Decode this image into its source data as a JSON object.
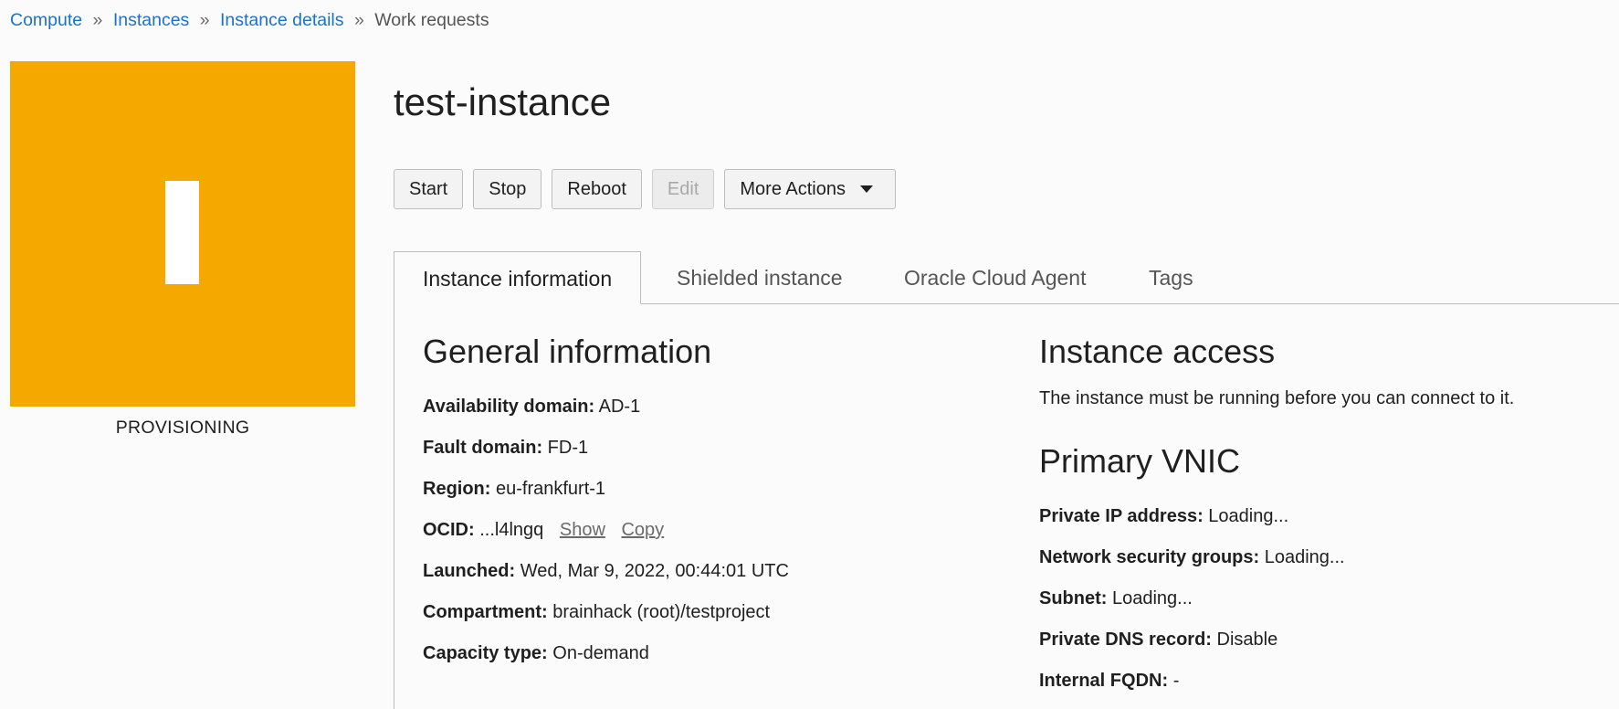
{
  "breadcrumb": {
    "items": [
      "Compute",
      "Instances",
      "Instance details"
    ],
    "current": "Work requests",
    "separator": "»"
  },
  "status": {
    "state": "PROVISIONING",
    "color": "#f5a800"
  },
  "instance": {
    "name": "test-instance"
  },
  "actions": {
    "start": "Start",
    "stop": "Stop",
    "reboot": "Reboot",
    "edit": "Edit",
    "more": "More Actions"
  },
  "tabs": {
    "instance_information": "Instance information",
    "shielded_instance": "Shielded instance",
    "oracle_cloud_agent": "Oracle Cloud Agent",
    "tags": "Tags"
  },
  "general": {
    "heading": "General information",
    "availability_domain": {
      "label": "Availability domain:",
      "value": "AD-1"
    },
    "fault_domain": {
      "label": "Fault domain:",
      "value": "FD-1"
    },
    "region": {
      "label": "Region:",
      "value": "eu-frankfurt-1"
    },
    "ocid": {
      "label": "OCID:",
      "value": "...l4lngq",
      "show": "Show",
      "copy": "Copy"
    },
    "launched": {
      "label": "Launched:",
      "value": "Wed, Mar 9, 2022, 00:44:01 UTC"
    },
    "compartment": {
      "label": "Compartment:",
      "value": "brainhack (root)/testproject"
    },
    "capacity_type": {
      "label": "Capacity type:",
      "value": "On-demand"
    }
  },
  "access": {
    "heading": "Instance access",
    "note": "The instance must be running before you can connect to it."
  },
  "vnic": {
    "heading": "Primary VNIC",
    "private_ip": {
      "label": "Private IP address:",
      "value": "Loading..."
    },
    "nsg": {
      "label": "Network security groups:",
      "value": "Loading..."
    },
    "subnet": {
      "label": "Subnet:",
      "value": "Loading..."
    },
    "private_dns": {
      "label": "Private DNS record:",
      "value": "Disable"
    },
    "internal_fqdn": {
      "label": "Internal FQDN:",
      "value": "-"
    }
  }
}
